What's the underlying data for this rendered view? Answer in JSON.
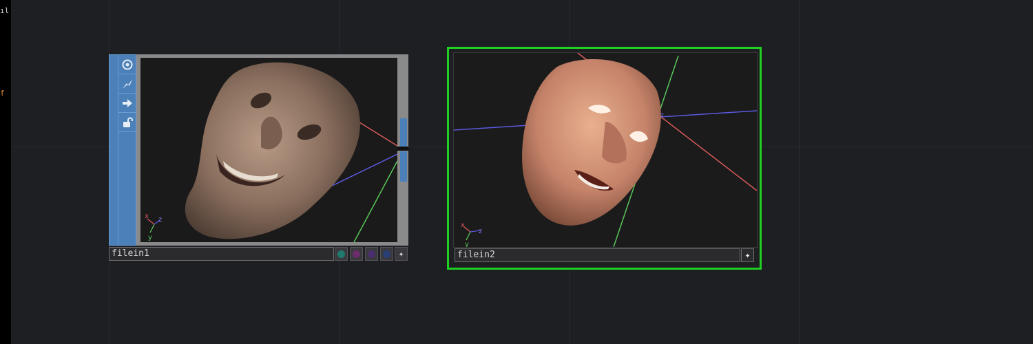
{
  "left_strip": {
    "glyph_top": "ıl",
    "glyph_mid": "f"
  },
  "nodes": [
    {
      "name": "filein1",
      "selected": false,
      "toolbar_icons": [
        "viewer-active-icon",
        "cook-icon",
        "export-icon",
        "lock-icon"
      ],
      "flags": [
        {
          "name": "flag-teal",
          "color": "#1f7a70"
        },
        {
          "name": "flag-magenta",
          "color": "#6a2d6a"
        },
        {
          "name": "flag-purple",
          "color": "#4a2f6e"
        },
        {
          "name": "flag-blue",
          "color": "#2a3f78"
        }
      ],
      "viewer_axis_labels": {
        "x": "x",
        "y": "y",
        "z": "z"
      }
    },
    {
      "name": "filein2",
      "selected": true,
      "selection_color": "#1fcf22",
      "viewer_axis_labels": {
        "x": "x",
        "y": "y",
        "z": "z"
      }
    }
  ],
  "colors": {
    "x_axis": "#d85a5a",
    "y_axis": "#5ac85a",
    "z_axis": "#5a5ae0",
    "toolbar": "#4b80b8"
  }
}
